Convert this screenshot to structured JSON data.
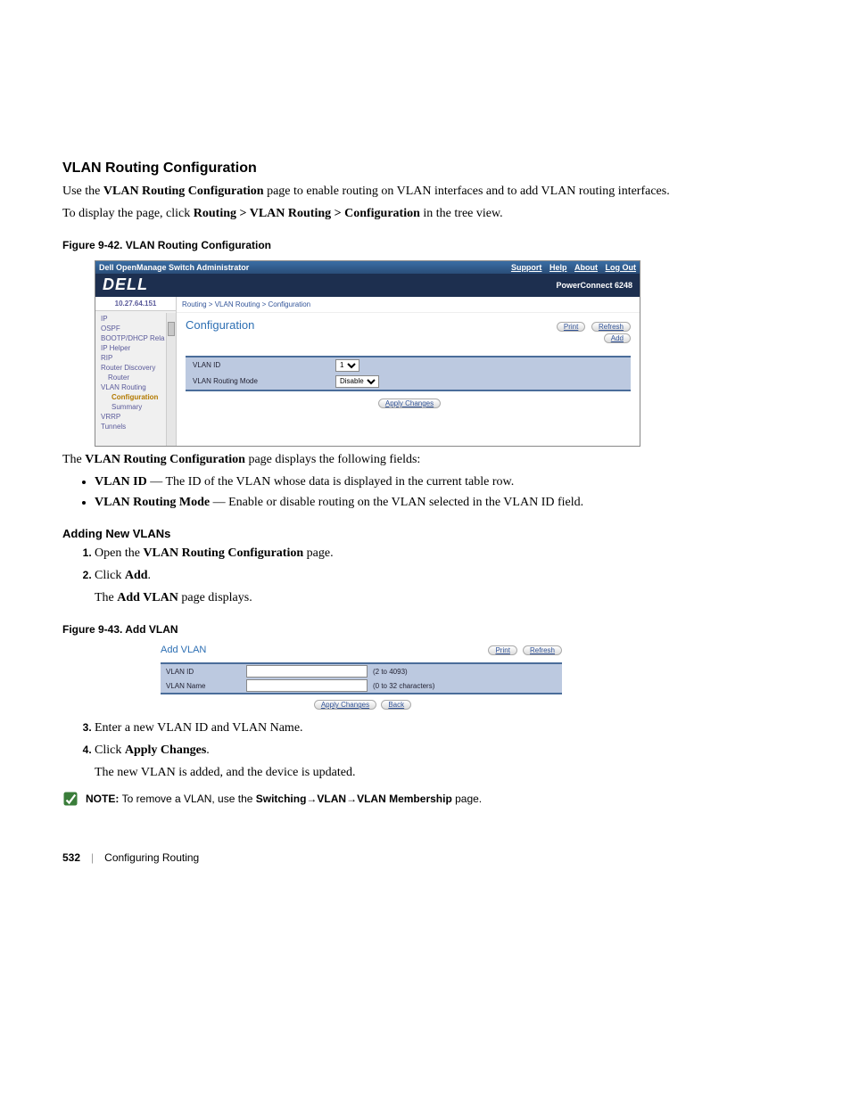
{
  "heading": "VLAN Routing Configuration",
  "intro_1a": "Use the ",
  "intro_1b": "VLAN Routing Configuration",
  "intro_1c": " page to enable routing on VLAN interfaces and to add VLAN routing interfaces.",
  "intro_2a": "To display the page, click ",
  "intro_2b": "Routing > VLAN Routing > Configuration",
  "intro_2c": " in the tree view.",
  "fig1_cap": "Figure 9-42.    VLAN Routing Configuration",
  "shot1": {
    "titlebar": "Dell OpenManage Switch Administrator",
    "nav": {
      "support": "Support",
      "help": "Help",
      "about": "About",
      "logout": "Log Out"
    },
    "logo": "DELL",
    "model": "PowerConnect 6248",
    "ip": "10.27.64.151",
    "tree": [
      "IP",
      "OSPF",
      "BOOTP/DHCP Rela",
      "IP Helper",
      "RIP",
      "Router Discovery",
      "Router",
      "VLAN Routing",
      "Configuration",
      "Summary",
      "VRRP",
      "Tunnels"
    ],
    "tree_sel_index": 8,
    "crumb": "Routing > VLAN Routing > Configuration",
    "title": "Configuration",
    "print": "Print",
    "refresh": "Refresh",
    "add": "Add",
    "field1": "VLAN ID",
    "field1_val": "1",
    "field2": "VLAN Routing Mode",
    "field2_val": "Disable",
    "apply": "Apply Changes"
  },
  "afterfig_a": "The ",
  "afterfig_b": "VLAN Routing Configuration",
  "afterfig_c": " page displays the following fields:",
  "bullets": [
    {
      "b": "VLAN ID",
      "t": " — The ID of the VLAN whose data is displayed in the current table row."
    },
    {
      "b": "VLAN Routing Mode",
      "t": " — Enable or disable routing on the VLAN selected in the VLAN ID field."
    }
  ],
  "subheading1": "Adding New VLANs",
  "step1_a": "Open the ",
  "step1_b": "VLAN Routing Configuration",
  "step1_c": " page.",
  "step2_a": "Click ",
  "step2_b": "Add",
  "step2_c": ".",
  "step2_d_a": "The ",
  "step2_d_b": "Add VLAN",
  "step2_d_c": " page displays.",
  "fig2_cap": "Figure 9-43.    Add VLAN",
  "shot2": {
    "title": "Add VLAN",
    "print": "Print",
    "refresh": "Refresh",
    "f1": "VLAN ID",
    "f1_hint": "(2 to 4093)",
    "f2": "VLAN Name",
    "f2_hint": "(0 to 32 characters)",
    "apply": "Apply Changes",
    "back": "Back"
  },
  "step3": "Enter a new VLAN ID and VLAN Name.",
  "step4_a": "Click ",
  "step4_b": "Apply Changes",
  "step4_c": ".",
  "step4_d": "The new VLAN is added, and the device is updated.",
  "note_a": "NOTE: ",
  "note_b": "To remove a VLAN, use the ",
  "note_c": "Switching",
  "note_arrow": "→",
  "note_d": "VLAN",
  "note_e": "VLAN Membership",
  "note_f": " page.",
  "footer_page": "532",
  "footer_sep": "|",
  "footer_chapter": "Configuring Routing"
}
